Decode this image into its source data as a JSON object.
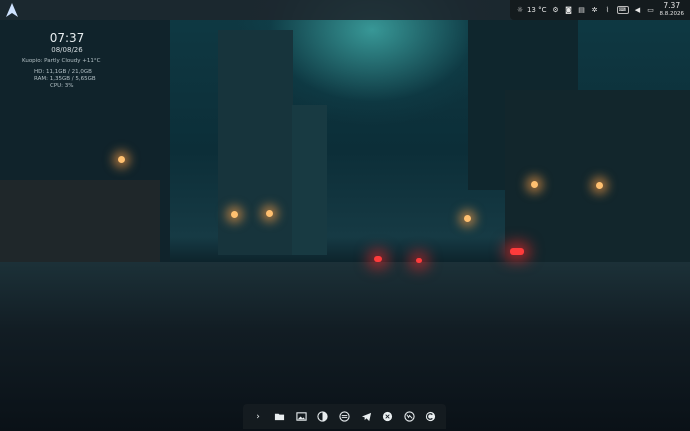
{
  "top_panel": {
    "weather_temp": "13 °C",
    "clock_time": "7.37",
    "clock_date": "8.8.2026",
    "tray_icons": [
      "weather-icon",
      "settings-icon",
      "screenshot-icon",
      "clipboard-icon",
      "gear-icon",
      "network-icon",
      "keyboard-layout-icon",
      "volume-icon",
      "battery-icon"
    ]
  },
  "conky": {
    "time": "07:37",
    "date": "08/08/26",
    "weather": "Kuopio: Partly Cloudy  +11°C",
    "hd": "HD:  11,1GB / 21,0GB",
    "ram": "RAM: 1,35GB / 5,65GB",
    "cpu": "CPU: 3%"
  },
  "dock": {
    "items": [
      "terminal-icon",
      "files-icon",
      "image-viewer-icon",
      "themes-icon",
      "system-settings-icon",
      "telegram-icon",
      "app-store-icon",
      "browser-icon",
      "ccleaner-icon"
    ]
  }
}
